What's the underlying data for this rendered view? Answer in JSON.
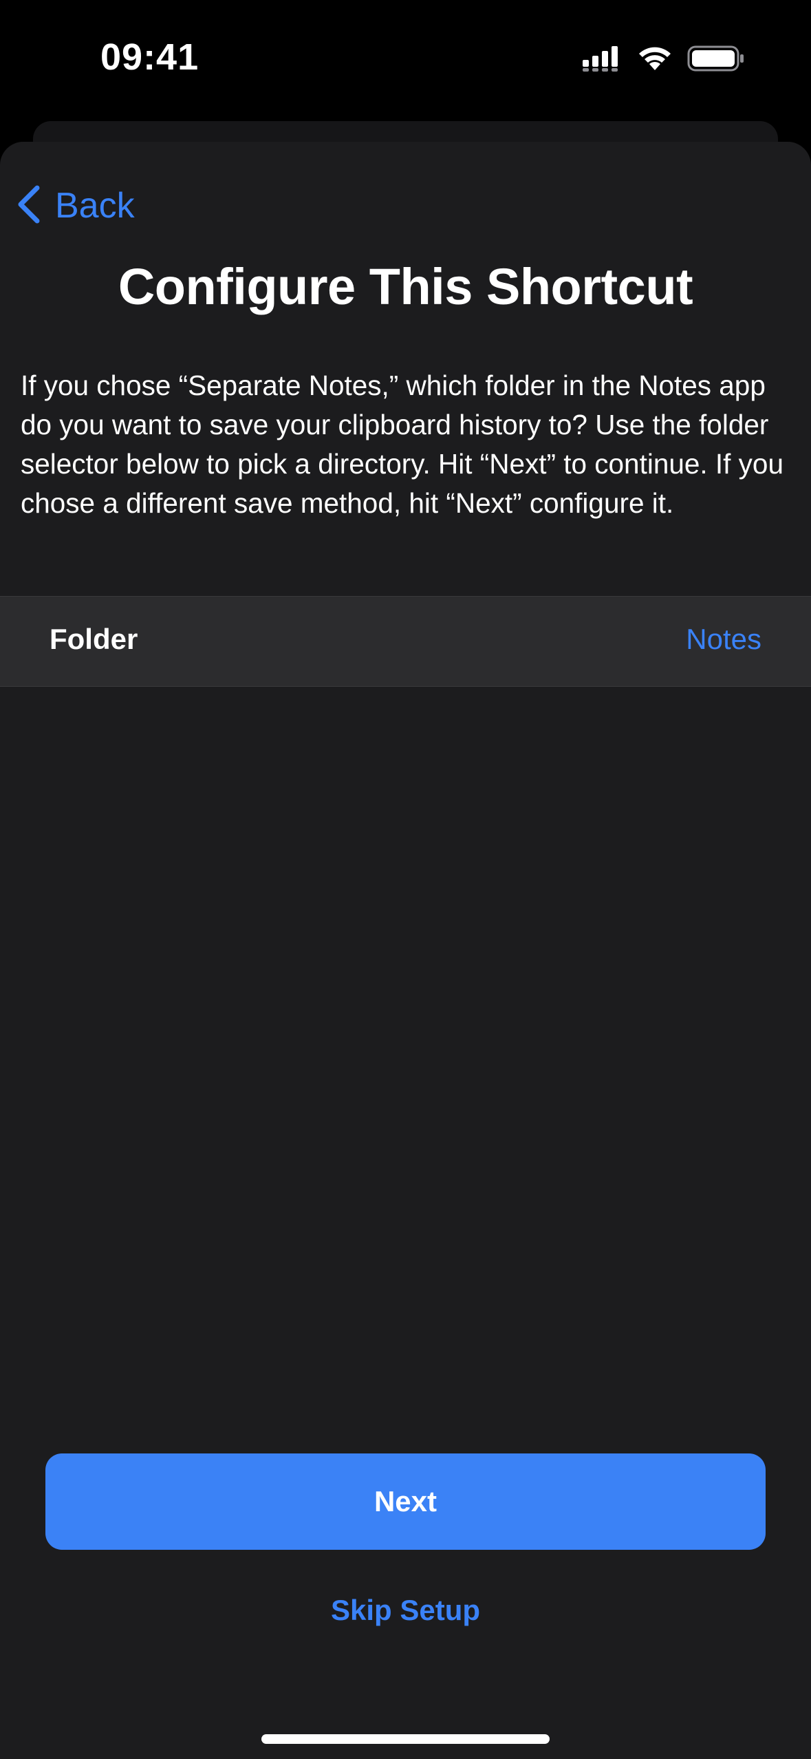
{
  "status_bar": {
    "time": "09:41",
    "icons": [
      "cellular-signal-icon",
      "wifi-icon",
      "battery-icon"
    ]
  },
  "nav": {
    "back_label": "Back",
    "back_icon": "chevron-left-icon"
  },
  "page": {
    "title": "Configure This Shortcut",
    "description": "If you chose “Separate Notes,” which folder in the Notes app do you want to save your clipboard history to? Use the folder selector below to pick a directory. Hit “Next” to continue. If you chose a different save method, hit “Next” configure it."
  },
  "folder_row": {
    "label": "Folder",
    "value": "Notes"
  },
  "actions": {
    "next_label": "Next",
    "skip_label": "Skip Setup"
  },
  "colors": {
    "accent": "#3a82f7",
    "button": "#3b82f6",
    "sheet_background": "#1c1c1e",
    "row_background": "#2c2c2e"
  }
}
